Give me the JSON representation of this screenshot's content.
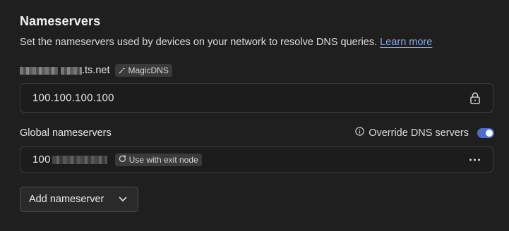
{
  "section": {
    "title": "Nameservers",
    "description": "Set the nameservers used by devices on your network to resolve DNS queries.",
    "learn_more": "Learn more"
  },
  "magic_dns": {
    "domain_suffix": ".ts.net",
    "badge_label": "MagicDNS",
    "badge_icon": "sparkle-icon",
    "nameserver": "100.100.100.100",
    "lock_icon": "lock-icon"
  },
  "global": {
    "label": "Global nameservers",
    "override_label": "Override DNS servers",
    "override_enabled": true,
    "info_icon": "info-icon",
    "nameserver_prefix": "100",
    "exit_node_label": "Use with exit node",
    "exit_node_icon": "exit-node-icon",
    "menu_icon": "more-horizontal-icon"
  },
  "add_button": {
    "label": "Add nameserver",
    "icon": "chevron-down-icon"
  },
  "colors": {
    "background": "#1f1f1f",
    "link": "#8aa5ee",
    "toggle_on": "#4a6fd3",
    "badge_bg": "#3a3a3a"
  }
}
